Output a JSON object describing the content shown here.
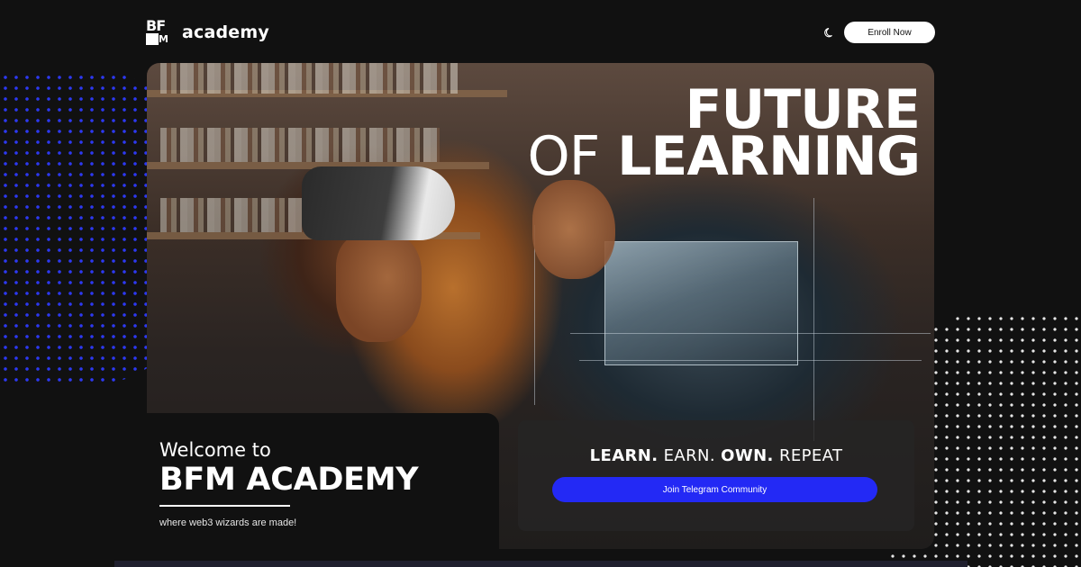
{
  "header": {
    "logo_letters": "BF",
    "logo_letter_m": "M",
    "logo_text": "academy",
    "theme_toggle_icon": "moon-icon",
    "enroll_label": "Enroll Now"
  },
  "hero": {
    "title_line1": "FUTURE",
    "title_line2_light": "OF",
    "title_line2_bold": "LEARNING"
  },
  "welcome": {
    "line1": "Welcome to",
    "line2": "BFM ACADEMY",
    "subtitle": "where web3 wizards are made!"
  },
  "cta": {
    "tag_learn": "LEARN.",
    "tag_earn": "EARN.",
    "tag_own": "OWN.",
    "tag_repeat": "REPEAT",
    "telegram_label": "Join Telegram Community"
  },
  "colors": {
    "background": "#111111",
    "accent_blue": "#2329f5",
    "dots_blue": "#2f3cff",
    "button_white": "#ffffff"
  }
}
